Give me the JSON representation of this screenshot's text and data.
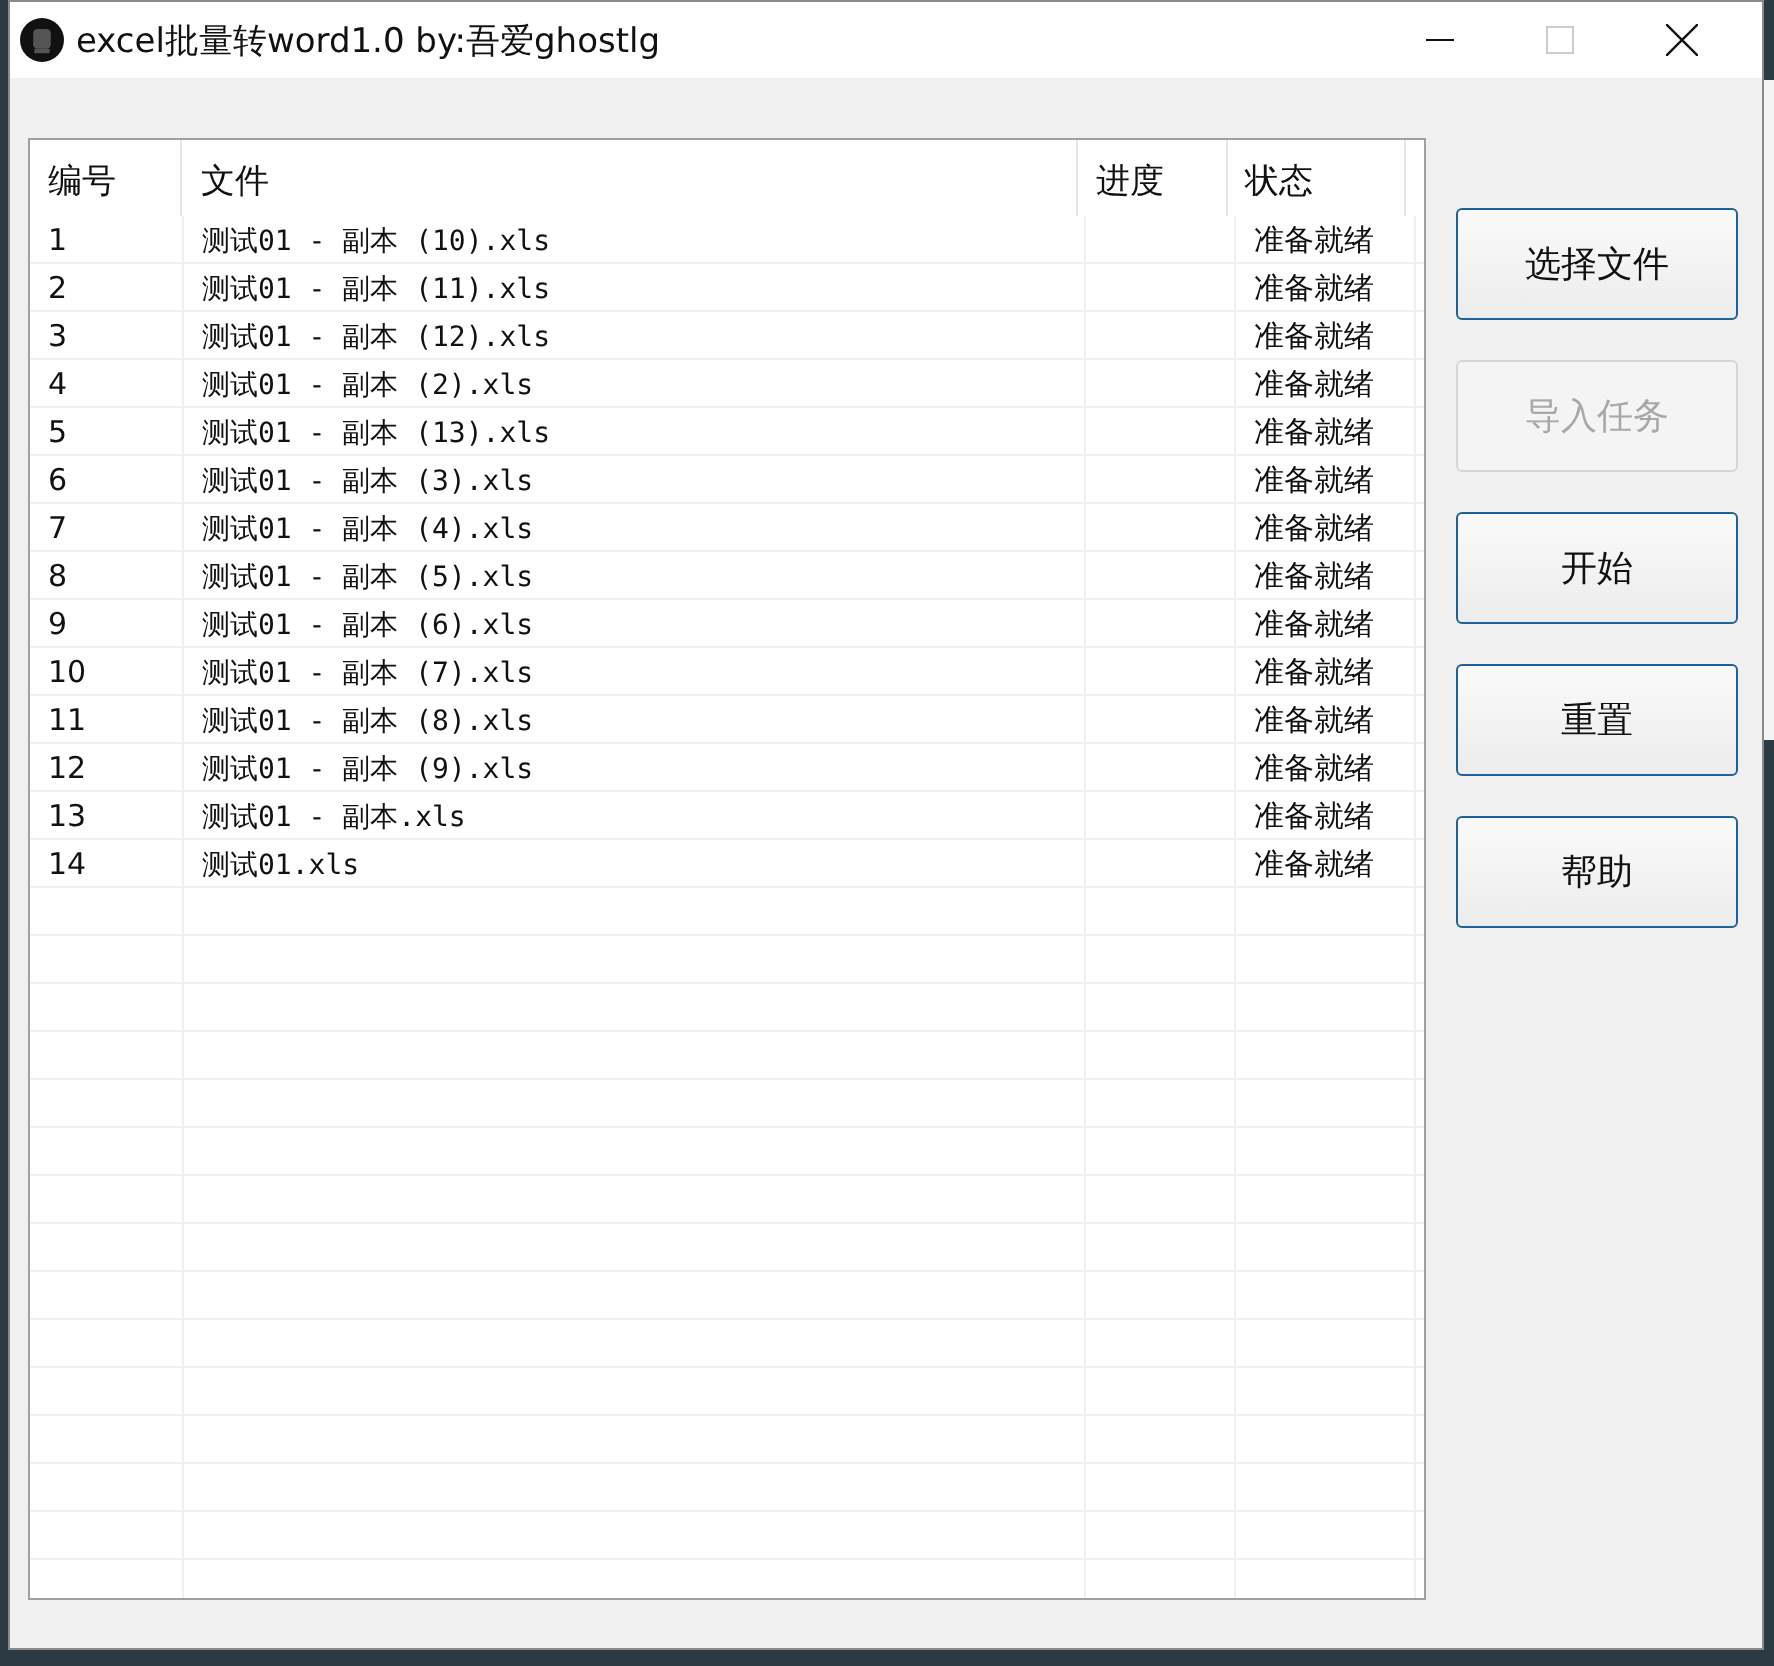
{
  "window": {
    "title": "excel批量转word1.0  by:吾爱ghostlg"
  },
  "table": {
    "columns": [
      "编号",
      "文件",
      "进度",
      "状态"
    ],
    "rows": [
      {
        "number": "1",
        "file": "测试01 - 副本 (10).xls",
        "status": "准备就绪"
      },
      {
        "number": "2",
        "file": "测试01 - 副本 (11).xls",
        "status": "准备就绪"
      },
      {
        "number": "3",
        "file": "测试01 - 副本 (12).xls",
        "status": "准备就绪"
      },
      {
        "number": "4",
        "file": "测试01 - 副本 (2).xls",
        "status": "准备就绪"
      },
      {
        "number": "5",
        "file": "测试01 - 副本 (13).xls",
        "status": "准备就绪"
      },
      {
        "number": "6",
        "file": "测试01 - 副本 (3).xls",
        "status": "准备就绪"
      },
      {
        "number": "7",
        "file": "测试01 - 副本 (4).xls",
        "status": "准备就绪"
      },
      {
        "number": "8",
        "file": "测试01 - 副本 (5).xls",
        "status": "准备就绪"
      },
      {
        "number": "9",
        "file": "测试01 - 副本 (6).xls",
        "status": "准备就绪"
      },
      {
        "number": "10",
        "file": "测试01 - 副本 (7).xls",
        "status": "准备就绪"
      },
      {
        "number": "11",
        "file": "测试01 - 副本 (8).xls",
        "status": "准备就绪"
      },
      {
        "number": "12",
        "file": "测试01 - 副本 (9).xls",
        "status": "准备就绪"
      },
      {
        "number": "13",
        "file": "测试01 - 副本.xls",
        "status": "准备就绪"
      },
      {
        "number": "14",
        "file": "测试01.xls",
        "status": "准备就绪"
      }
    ]
  },
  "buttons": [
    {
      "label": "选择文件",
      "disabled": false
    },
    {
      "label": "导入任务",
      "disabled": true
    },
    {
      "label": "开始",
      "disabled": false
    },
    {
      "label": "重置",
      "disabled": false
    },
    {
      "label": "帮助",
      "disabled": false
    }
  ]
}
